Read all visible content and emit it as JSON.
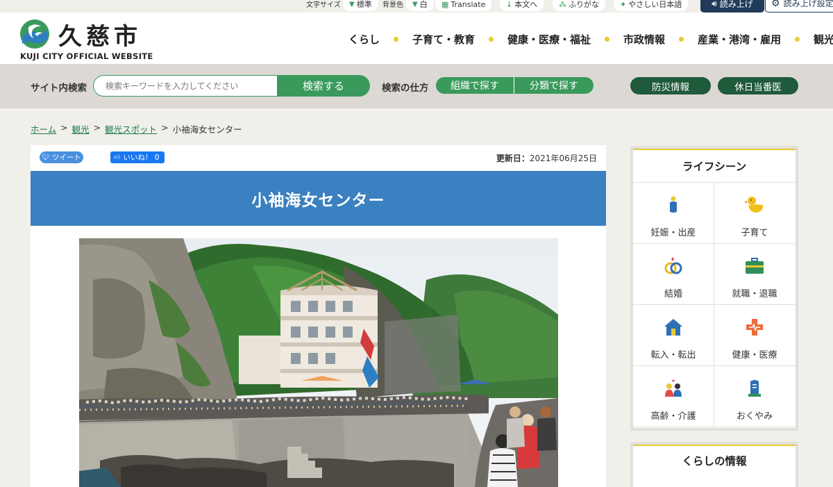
{
  "utility": {
    "font_size_label": "文字サイズ",
    "font_size_value": "標準",
    "bg_color_label": "背景色",
    "bg_color_value": "白",
    "translate": "Translate",
    "jump_to_main": "本文へ",
    "furigana": "ふりがな",
    "easy_japanese": "やさしい日本語",
    "read_aloud": "読み上げ",
    "read_settings": "読み上げ設定"
  },
  "header": {
    "site_name": "久慈市",
    "site_subtitle": "KUJI CITY OFFICIAL WEBSITE",
    "nav": [
      "くらし",
      "子育て・教育",
      "健康・医療・福祉",
      "市政情報",
      "産業・港湾・雇用",
      "観光"
    ]
  },
  "search": {
    "label": "サイト内検索",
    "placeholder": "検索キーワードを入力してください",
    "button": "検索する",
    "method_label": "検索の仕方",
    "by_org": "組織で探す",
    "by_category": "分類で探す",
    "disaster": "防災情報",
    "holiday_doctor": "休日当番医"
  },
  "breadcrumb": {
    "home": "ホーム",
    "sep": ">",
    "tourism": "観光",
    "spots": "観光スポット",
    "current": "小袖海女センター"
  },
  "article": {
    "tweet": "ツイート",
    "like": "いいね！ 0",
    "updated_label": "更新日：",
    "updated_date": "2021年06月25日",
    "title": "小袖海女センター"
  },
  "sidebar": {
    "life_scene_title": "ライフシーン",
    "items": [
      {
        "label": "妊娠・出産",
        "icon": "pregnancy-icon"
      },
      {
        "label": "子育て",
        "icon": "duck-icon"
      },
      {
        "label": "結婚",
        "icon": "rings-icon"
      },
      {
        "label": "就職・退職",
        "icon": "briefcase-icon"
      },
      {
        "label": "転入・転出",
        "icon": "house-icon"
      },
      {
        "label": "健康・医療",
        "icon": "medical-cross-icon"
      },
      {
        "label": "高齢・介護",
        "icon": "elderly-icon"
      },
      {
        "label": "おくやみ",
        "icon": "gravestone-icon"
      }
    ],
    "life_info_title": "くらしの情報"
  },
  "colors": {
    "green": "#3a9a5c",
    "dark_green": "#1f5a3b",
    "title_blue": "#3b80c0",
    "navy": "#1f3b57",
    "yellow": "#e8c931"
  }
}
